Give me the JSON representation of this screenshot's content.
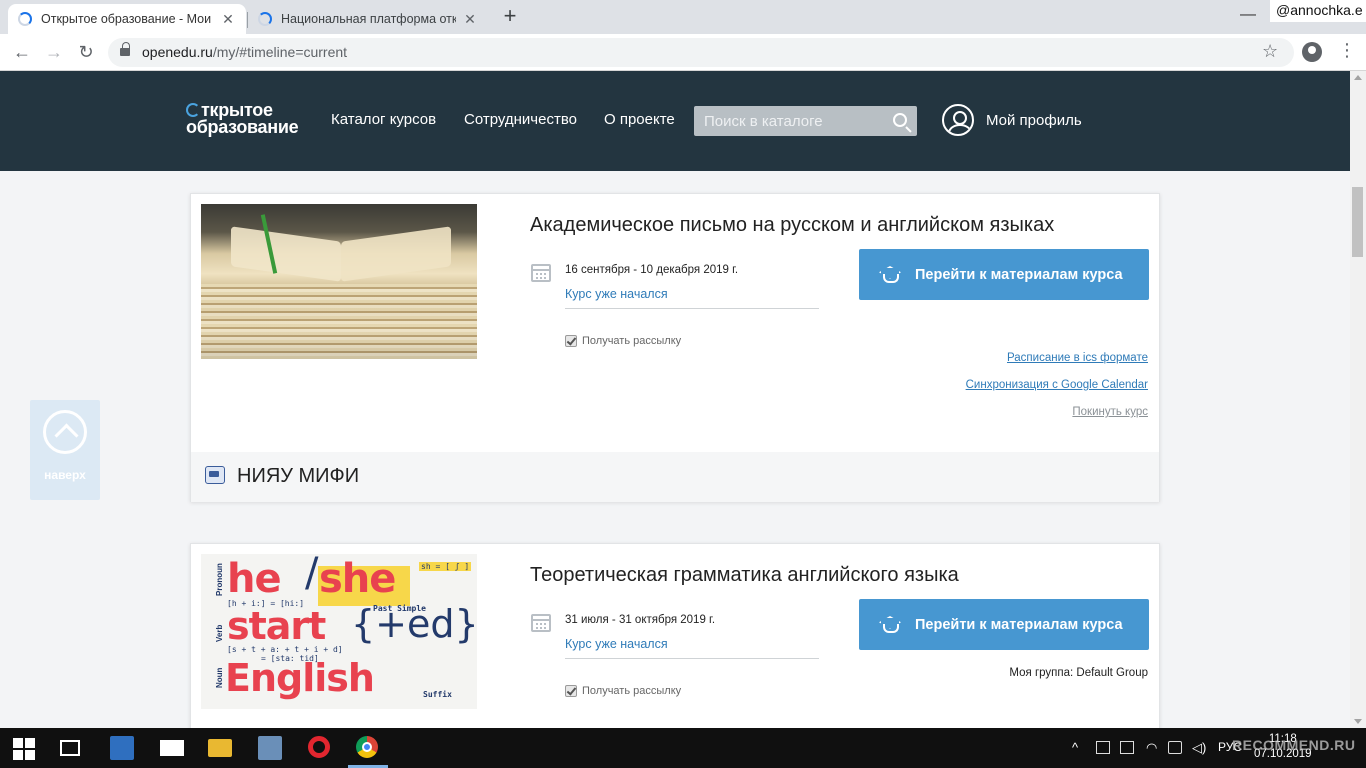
{
  "browser": {
    "tabs": [
      {
        "title": "Открытое образование - Мои к",
        "active": true
      },
      {
        "title": "Национальная платформа откр",
        "active": false
      }
    ],
    "new_tab_icon": "plus-icon",
    "minimize_label": "—",
    "user_badge": "@annochka.e",
    "url_domain": "openedu.ru",
    "url_path": "/my/#timeline=current"
  },
  "header": {
    "logo_line1": "ткрытое",
    "logo_line2": "образование",
    "nav": [
      "Каталог курсов",
      "Сотрудничество",
      "О проекте"
    ],
    "search_placeholder": "Поиск в каталоге",
    "profile_label": "Мой профиль"
  },
  "back_to_top": {
    "label": "наверх"
  },
  "courses": [
    {
      "title": "Академическое письмо на русском и английском языках",
      "dates": "16 сентября - 10 декабря 2019 г.",
      "status": "Курс уже начался",
      "newsletter": "Получать рассылку",
      "newsletter_checked": true,
      "button": "Перейти к материалам курса",
      "links": [
        "Расписание в ics формате",
        "Синхронизация с Google Calendar",
        "Покинуть курс"
      ],
      "university": "НИЯУ МИФИ"
    },
    {
      "title": "Теоретическая грамматика английского языка",
      "dates": "31 июля - 31 октября 2019 г.",
      "status": "Курс уже начался",
      "newsletter": "Получать рассылку",
      "newsletter_checked": true,
      "button": "Перейти к материалам курса",
      "group": "Моя группа: Default Group",
      "image_text": {
        "he": "he",
        "slash": "/",
        "she": "she",
        "start": "start",
        "english": "English",
        "plus_ed": "{+ed}",
        "sh_ipa": "sh = [ ʃ ]",
        "hi_ipa": "[h + i:] = [hi:]",
        "past_simple": "Past Simple",
        "start_ipa": "[s + t + a: + t + i + d]",
        "started_ipa": "= [sta: tid]",
        "suffix": "Suffix",
        "pronoun": "Pronoun",
        "verb": "Verb",
        "noun": "Noun"
      }
    }
  ],
  "taskbar": {
    "lang": "РУС",
    "time": "11:18",
    "date": "07.10.2019",
    "watermark": "RECOMMEND.RU",
    "colors": {
      "accent": "#4797d1",
      "header": "#233540"
    }
  }
}
